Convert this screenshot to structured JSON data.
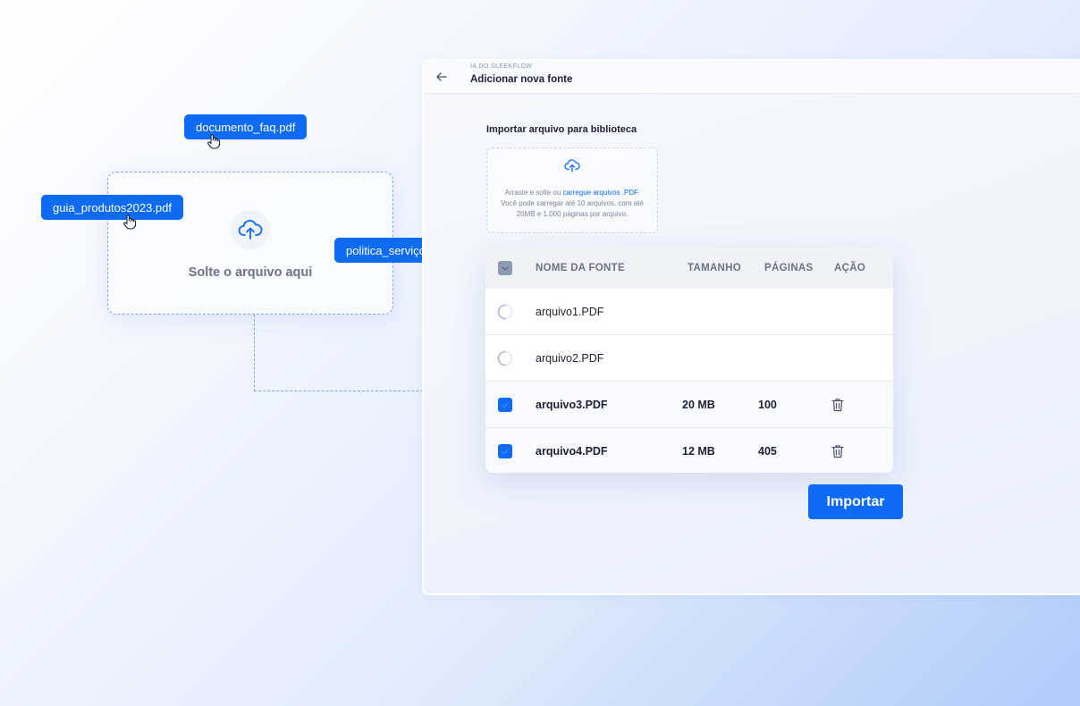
{
  "floating_dropzone": {
    "text": "Solte o arquivo aqui"
  },
  "dragged_files": [
    "documento_faq.pdf",
    "guia_produtos2023.pdf",
    "politica_serviços.pdf"
  ],
  "panel": {
    "breadcrumb": "IA DO SLEEKFLOW",
    "title": "Adicionar nova fonte",
    "section_title": "Importar arquivo para biblioteca",
    "upload": {
      "text_before": "Arraste e solte ou ",
      "link_text": "carregue arquivos .PDF",
      "text_after": ". Você pode carregar até 10 arquivos, com até 20MB e 1.000 páginas por arquivo."
    }
  },
  "table": {
    "columns": [
      "NOME DA FONTE",
      "TAMANHO",
      "PÁGINAS",
      "AÇÃO"
    ],
    "rows": [
      {
        "name": "arquivo1.PDF",
        "size": "",
        "pages": "",
        "status": "loading"
      },
      {
        "name": "arquivo2.PDF",
        "size": "",
        "pages": "",
        "status": "loading"
      },
      {
        "name": "arquivo3.PDF",
        "size": "20 MB",
        "pages": "100",
        "status": "selected"
      },
      {
        "name": "arquivo4.PDF",
        "size": "12 MB",
        "pages": "405",
        "status": "selected"
      }
    ]
  },
  "import_button": "Importar",
  "icons": {
    "back": "arrow-left-icon",
    "upload": "cloud-upload-icon",
    "loading": "spinner-icon",
    "checkbox": "check-icon",
    "delete": "trash-icon",
    "cursor": "hand-cursor-icon"
  },
  "colors": {
    "accent": "#0d6bf5",
    "text": "#1c2233",
    "muted": "#6b7384",
    "dashed": "#7fa8e8"
  }
}
